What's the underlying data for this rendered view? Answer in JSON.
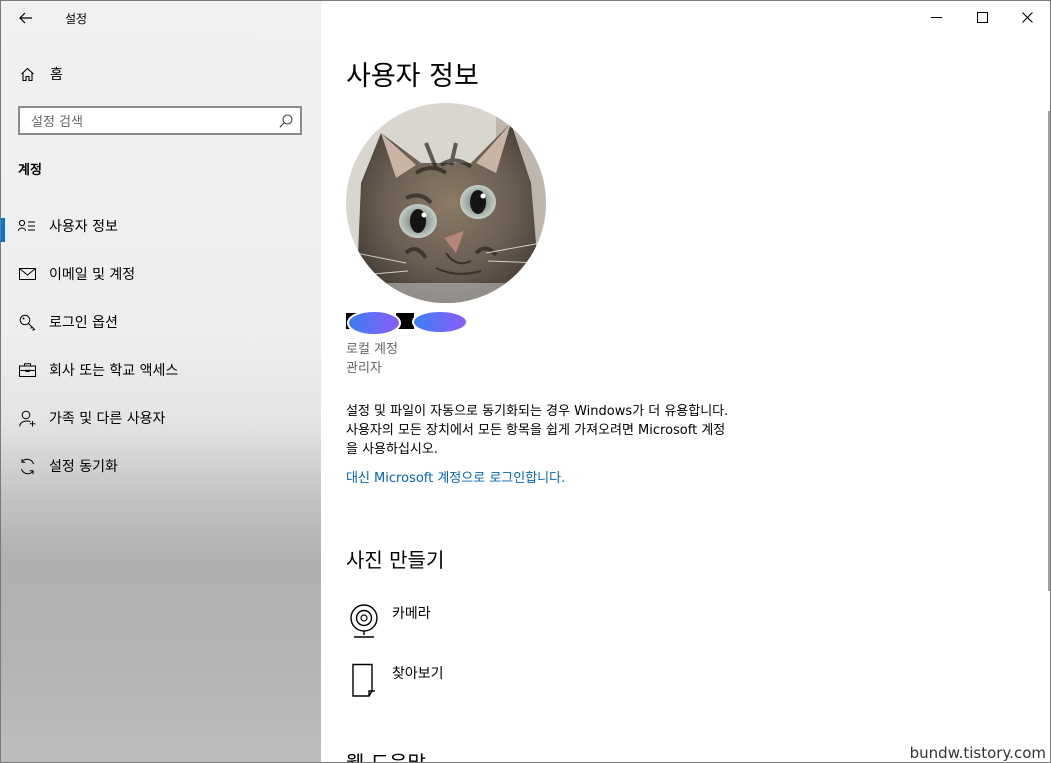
{
  "window": {
    "title": "설정"
  },
  "sidebar": {
    "home_label": "홈",
    "search_placeholder": "설정 검색",
    "section": "계정",
    "items": [
      {
        "label": "사용자 정보",
        "icon": "user-info-icon",
        "selected": true
      },
      {
        "label": "이메일 및 계정",
        "icon": "mail-icon",
        "selected": false
      },
      {
        "label": "로그인 옵션",
        "icon": "key-icon",
        "selected": false
      },
      {
        "label": "회사 또는 학교 액세스",
        "icon": "briefcase-icon",
        "selected": false
      },
      {
        "label": "가족 및 다른 사용자",
        "icon": "person-add-icon",
        "selected": false
      },
      {
        "label": "설정 동기화",
        "icon": "sync-icon",
        "selected": false
      }
    ]
  },
  "main": {
    "title": "사용자 정보",
    "account_type": "로컬 계정",
    "account_role": "관리자",
    "info_lines": [
      "설정 및 파일이 자동으로 동기화되는 경우 Windows가 더 유용합니다.",
      "사용자의 모든 장치에서 모든 항목을 쉽게 가져오려면 Microsoft 계정",
      "을 사용하십시오."
    ],
    "signin_link": "대신 Microsoft 계정으로 로그인합니다.",
    "create_photo_title": "사진 만들기",
    "options": [
      {
        "label": "카메라",
        "icon": "camera-icon"
      },
      {
        "label": "찾아보기",
        "icon": "browse-file-icon"
      }
    ],
    "partial_section_title": "웹 도움말"
  },
  "watermark": "bundw.tistory.com",
  "colors": {
    "accent": "#0078d7",
    "link": "#0067b8"
  }
}
